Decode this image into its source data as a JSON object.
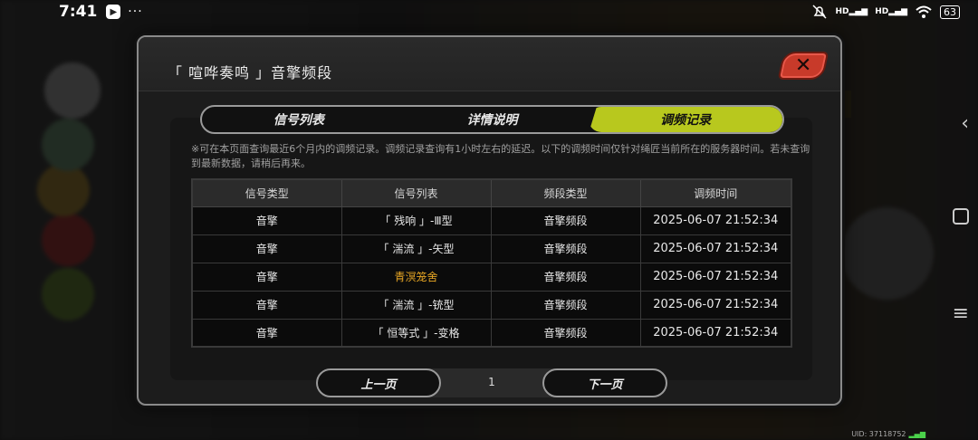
{
  "status_bar": {
    "time": "7:41",
    "app_icon_glyph": "▶",
    "dots": "···",
    "network_1": "HD",
    "network_2": "HD",
    "battery": "63"
  },
  "dialog": {
    "title": "「 喧哗奏鸣 」音擎频段",
    "tabs": [
      {
        "label": "信号列表",
        "active": false
      },
      {
        "label": "详情说明",
        "active": false
      },
      {
        "label": "调频记录",
        "active": true
      }
    ],
    "notice": "※可在本页面查询最近6个月内的调频记录。调频记录查询有1小时左右的延迟。以下的调频时间仅针对绳匠当前所在的服务器时间。若未查询到最新数据，请稍后再来。",
    "table": {
      "headers": [
        "信号类型",
        "信号列表",
        "频段类型",
        "调频时间"
      ],
      "rows": [
        {
          "type": "音擎",
          "name": "「 残响 」-Ⅲ型",
          "band": "音擎频段",
          "time": "2025-06-07 21:52:34",
          "highlight": false
        },
        {
          "type": "音擎",
          "name": "「 湍流 」-矢型",
          "band": "音擎频段",
          "time": "2025-06-07 21:52:34",
          "highlight": false
        },
        {
          "type": "音擎",
          "name": "青溟笼舍",
          "band": "音擎频段",
          "time": "2025-06-07 21:52:34",
          "highlight": true
        },
        {
          "type": "音擎",
          "name": "「 湍流 」-铳型",
          "band": "音擎频段",
          "time": "2025-06-07 21:52:34",
          "highlight": false
        },
        {
          "type": "音擎",
          "name": "「 恒等式 」-变格",
          "band": "音擎频段",
          "time": "2025-06-07 21:52:34",
          "highlight": false
        }
      ]
    },
    "pager": {
      "prev_label": "上一页",
      "page": "1",
      "next_label": "下一页"
    }
  },
  "footer": {
    "uid": "UID: 37118752"
  },
  "colors": {
    "accent": "#b8c81e",
    "highlight_text": "#e6a524",
    "close_button": "#c83a2a"
  },
  "icons": [
    "app-icon",
    "do-not-disturb-icon",
    "signal-icon",
    "wifi-icon",
    "battery-icon",
    "close-icon",
    "back-icon",
    "home-icon",
    "recents-icon"
  ]
}
